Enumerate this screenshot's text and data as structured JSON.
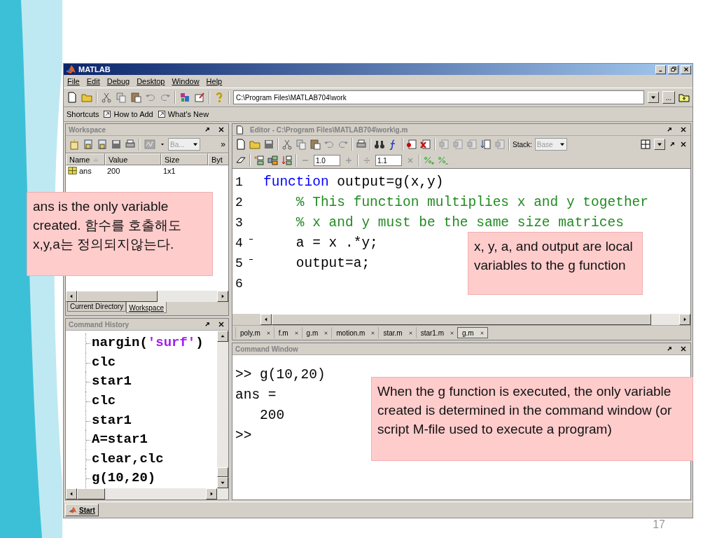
{
  "window": {
    "title": "MATLAB"
  },
  "menu": [
    "File",
    "Edit",
    "Debug",
    "Desktop",
    "Window",
    "Help"
  ],
  "current_directory": "C:\\Program Files\\MATLAB704\\work",
  "browse_button": "...",
  "shortcuts": {
    "label": "Shortcuts",
    "items": [
      "How to Add",
      "What's New"
    ]
  },
  "workspace": {
    "title": "Workspace",
    "stack": "Ba...",
    "more": "»",
    "columns": [
      "Name",
      "Value",
      "Size",
      "Byt"
    ],
    "rows": [
      {
        "name": "ans",
        "value": "200",
        "size": "1x1"
      }
    ],
    "tabs": [
      {
        "label": "Current Directory",
        "selected": false
      },
      {
        "label": "Workspace",
        "selected": true
      }
    ]
  },
  "command_history": {
    "title": "Command History",
    "entries": [
      {
        "segments": [
          {
            "kind": "plain",
            "text": "nargin("
          },
          {
            "kind": "string",
            "text": "'surf'"
          },
          {
            "kind": "plain",
            "text": ")"
          }
        ]
      },
      {
        "segments": [
          {
            "kind": "plain",
            "text": "clc"
          }
        ]
      },
      {
        "segments": [
          {
            "kind": "plain",
            "text": "star1"
          }
        ]
      },
      {
        "segments": [
          {
            "kind": "plain",
            "text": "clc"
          }
        ]
      },
      {
        "segments": [
          {
            "kind": "plain",
            "text": "star1"
          }
        ]
      },
      {
        "segments": [
          {
            "kind": "plain",
            "text": "A=star1"
          }
        ]
      },
      {
        "segments": [
          {
            "kind": "plain",
            "text": "clear,clc"
          }
        ]
      },
      {
        "segments": [
          {
            "kind": "plain",
            "text": "g(10,20)"
          }
        ]
      }
    ]
  },
  "editor": {
    "title": "Editor - C:\\Program Files\\MATLAB704\\work\\g.m",
    "stack_label": "Stack:",
    "stack": "Base",
    "cell_decrement": "1.0",
    "cell_divide": "1.1",
    "lines": [
      {
        "number": "1",
        "executable": false,
        "segments": [
          {
            "kind": "keyword",
            "text": "function"
          },
          {
            "kind": "plain",
            "text": " output=g(x,y)"
          }
        ]
      },
      {
        "number": "2",
        "executable": false,
        "segments": [
          {
            "kind": "comment",
            "text": "    % This function multiplies x and y together"
          }
        ]
      },
      {
        "number": "3",
        "executable": false,
        "segments": [
          {
            "kind": "comment",
            "text": "    % x and y must be the same size matrices"
          }
        ]
      },
      {
        "number": "4",
        "executable": true,
        "segments": [
          {
            "kind": "plain",
            "text": "    a = x .*y;"
          }
        ]
      },
      {
        "number": "5",
        "executable": true,
        "segments": [
          {
            "kind": "plain",
            "text": "    output=a;"
          }
        ]
      },
      {
        "number": "6",
        "executable": false
      }
    ],
    "file_tabs": [
      {
        "label": "poly.m",
        "selected": false
      },
      {
        "label": "f.m",
        "selected": false
      },
      {
        "label": "g.m",
        "selected": false
      },
      {
        "label": "motion.m",
        "selected": false
      },
      {
        "label": "star.m",
        "selected": false
      },
      {
        "label": "star1.m",
        "selected": false
      },
      {
        "label": "g.m",
        "selected": true
      }
    ]
  },
  "command_window": {
    "title": "Command Window",
    "lines": [
      ">> g(10,20)",
      "ans =",
      "   200",
      ">>"
    ]
  },
  "taskbar": {
    "start": "Start"
  },
  "callouts": [
    {
      "text": "ans is the only variable created. 함수를 호출해도 x,y,a는 정의되지않는다."
    },
    {
      "text": "x, y, a, and output  are local variables to the g function"
    },
    {
      "text": "When the g function is executed, the only variable created is determined in the command window (or script M-file used to execute a program)"
    }
  ],
  "slide_number": "17"
}
